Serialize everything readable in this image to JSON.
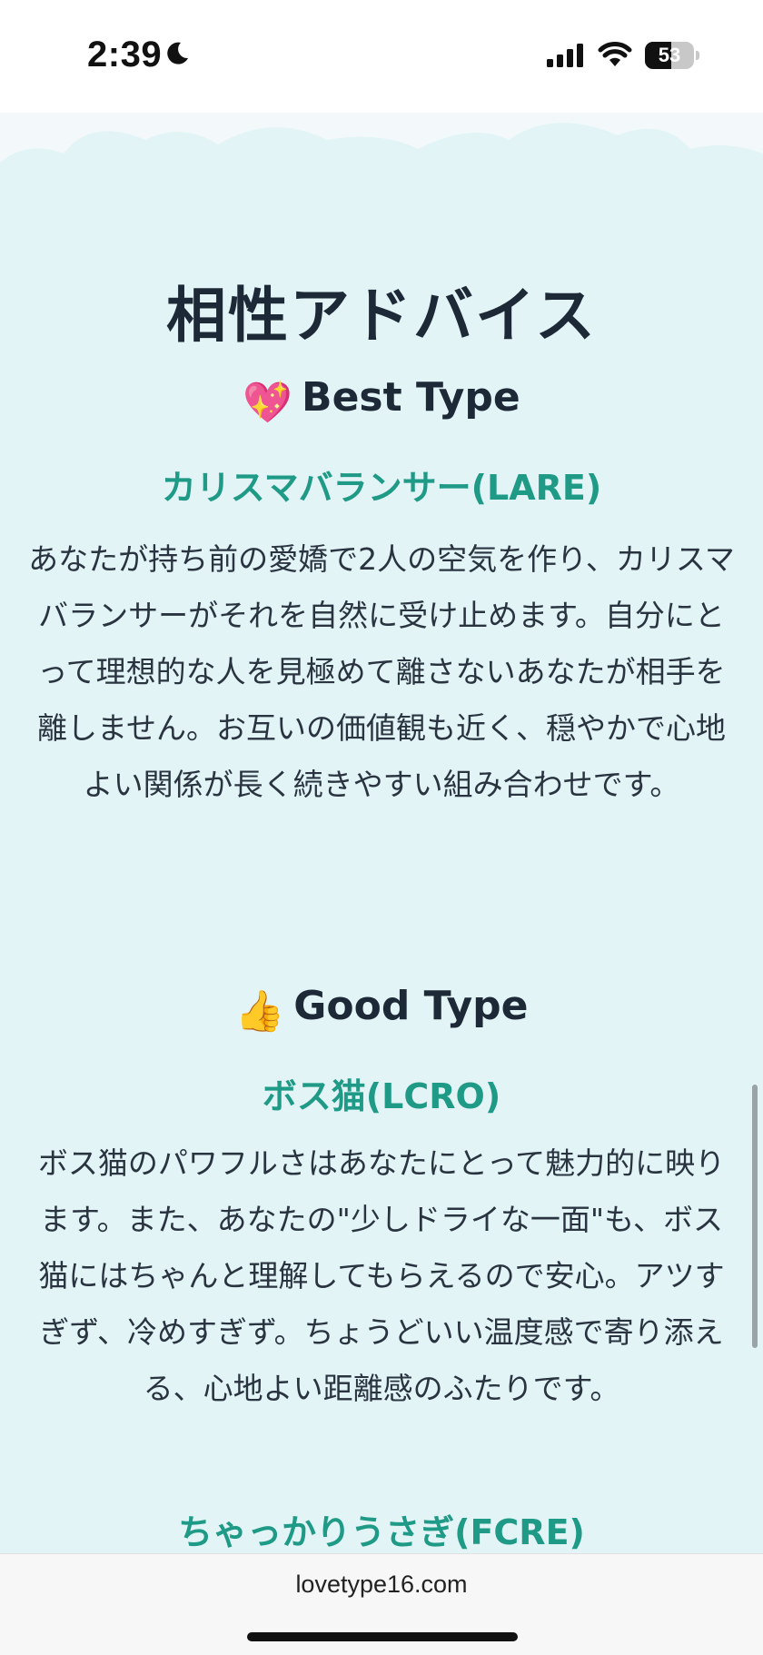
{
  "status_bar": {
    "time": "2:39",
    "battery_label": "53",
    "battery_level": 0.53
  },
  "page": {
    "heading": "相性アドバイス",
    "best": {
      "emoji": "💖",
      "label": "Best Type",
      "type_name": "カリスマバランサー(LARE)",
      "description": "あなたが持ち前の愛嬌で2人の空気を作り、カリスマバランサーがそれを自然に受け止めます。自分にとって理想的な人を見極めて離さないあなたが相手を離しません。お互いの価値観も近く、穏やかで心地よい関係が長く続きやすい組み合わせです。"
    },
    "good": {
      "emoji": "👍",
      "label": "Good Type",
      "type_name": "ボス猫(LCRO)",
      "description": "ボス猫のパワフルさはあなたにとって魅力的に映ります。また、あなたの\"少しドライな一面\"も、ボス猫にはちゃんと理解してもらえるので安心。アツすぎず、冷めすぎず。ちょうどいい温度感で寄り添える、心地よい距離感のふたりです。",
      "next_type_name": "ちゃっかりうさぎ(FCRE)"
    }
  },
  "browser": {
    "url": "lovetype16.com"
  }
}
